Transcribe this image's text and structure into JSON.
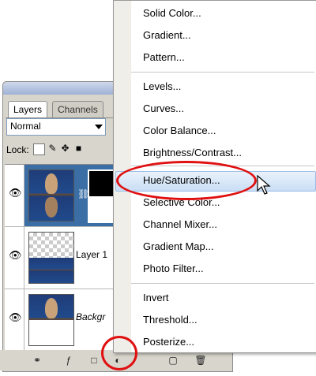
{
  "panel": {
    "tabs": [
      "Layers",
      "Channels"
    ],
    "blend_mode": "Normal",
    "lock_label": "Lock:",
    "layers": [
      {
        "name": "",
        "selected": true,
        "has_mask": true
      },
      {
        "name": "Layer 1",
        "selected": false
      },
      {
        "name": "Backgr",
        "selected": false
      }
    ]
  },
  "menu": {
    "group1": [
      "Solid Color...",
      "Gradient...",
      "Pattern..."
    ],
    "group2": [
      "Levels...",
      "Curves...",
      "Color Balance...",
      "Brightness/Contrast..."
    ],
    "group3": [
      "Hue/Saturation...",
      "Selective Color...",
      "Channel Mixer...",
      "Gradient Map...",
      "Photo Filter..."
    ],
    "group4": [
      "Invert",
      "Threshold...",
      "Posterize..."
    ],
    "highlighted": "Hue/Saturation..."
  },
  "icons": {
    "eye": "eye-icon",
    "link": "chain-link-icon",
    "adjustment": "half-circle-adjustment-icon",
    "cursor": "arrow-cursor-icon"
  },
  "colors": {
    "selection": "#3a6ea5",
    "annotation": "#e01010",
    "menu_hover": "#c9def5"
  }
}
